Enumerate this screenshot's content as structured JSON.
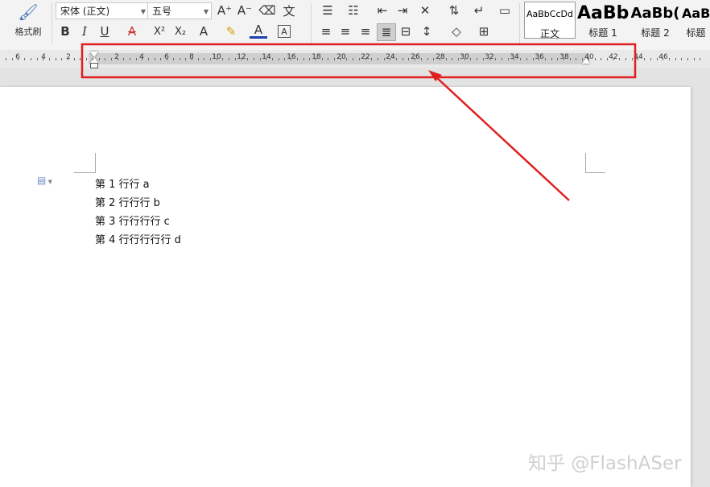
{
  "toolbar": {
    "format_painter_label": "格式刷",
    "font_name": "宋体 (正文)",
    "font_size": "五号",
    "bold": "B",
    "italic": "I",
    "underline": "U",
    "superscript": "X²",
    "subscript": "X₂",
    "text_effect": "A",
    "font_color": "A",
    "char_border": "A",
    "grow_font": "A⁺",
    "shrink_font": "A⁻",
    "phonetic": "文"
  },
  "styles": [
    {
      "preview": "AaBbCcDd",
      "name": "正文"
    },
    {
      "preview": "AaBb",
      "name": "标题 1"
    },
    {
      "preview": "AaBb(",
      "name": "标题 2"
    },
    {
      "preview": "AaBl",
      "name": "标题"
    }
  ],
  "ruler": {
    "labels": [
      "6",
      "4",
      "2",
      "2",
      "4",
      "6",
      "8",
      "10",
      "12",
      "14",
      "16",
      "18",
      "20",
      "22",
      "24",
      "26",
      "28",
      "30",
      "32",
      "34",
      "36",
      "38",
      "40",
      "42",
      "44",
      "46"
    ]
  },
  "document": {
    "lines": [
      "第 1 行行 a",
      "第 2 行行行 b",
      "第 3 行行行行 c",
      "第 4 行行行行行 d"
    ]
  },
  "watermark": "知乎 @FlashASer",
  "annotation": {
    "color": "#e02020"
  }
}
